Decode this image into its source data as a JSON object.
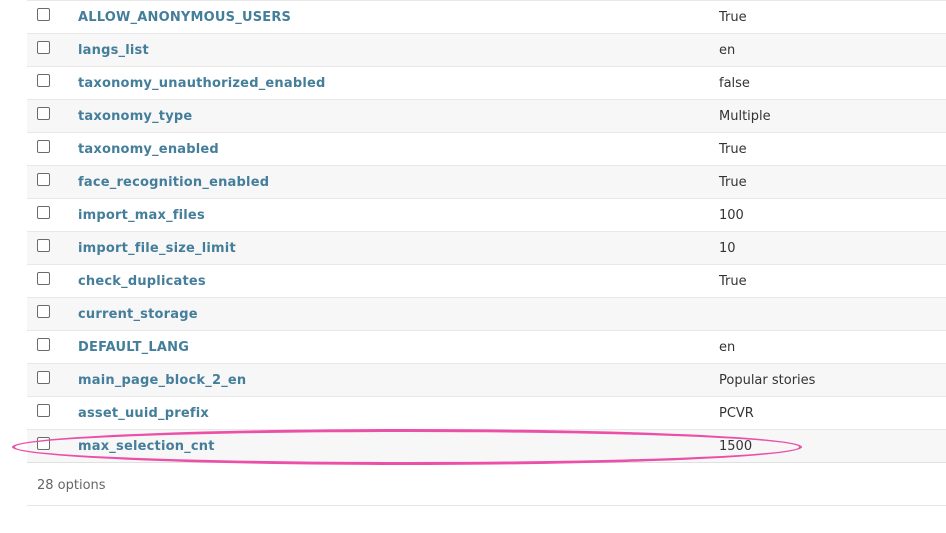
{
  "table": {
    "rows": [
      {
        "name": "ALLOW_ANONYMOUS_USERS",
        "value": "True"
      },
      {
        "name": "langs_list",
        "value": "en"
      },
      {
        "name": "taxonomy_unauthorized_enabled",
        "value": "false"
      },
      {
        "name": "taxonomy_type",
        "value": "Multiple"
      },
      {
        "name": "taxonomy_enabled",
        "value": "True"
      },
      {
        "name": "face_recognition_enabled",
        "value": "True"
      },
      {
        "name": "import_max_files",
        "value": "100"
      },
      {
        "name": "import_file_size_limit",
        "value": "10"
      },
      {
        "name": "check_duplicates",
        "value": "True"
      },
      {
        "name": "current_storage",
        "value": ""
      },
      {
        "name": "DEFAULT_LANG",
        "value": "en"
      },
      {
        "name": "main_page_block_2_en",
        "value": "Popular stories"
      },
      {
        "name": "asset_uuid_prefix",
        "value": "PCVR"
      },
      {
        "name": "max_selection_cnt",
        "value": "1500"
      }
    ]
  },
  "paginator": {
    "count_text": "28 options"
  },
  "annotation": {
    "highlighted_row": "max_selection_cnt",
    "color": "#ec4fa8"
  },
  "colors": {
    "link": "#447e9b",
    "row_alt": "#f7f7f7"
  }
}
